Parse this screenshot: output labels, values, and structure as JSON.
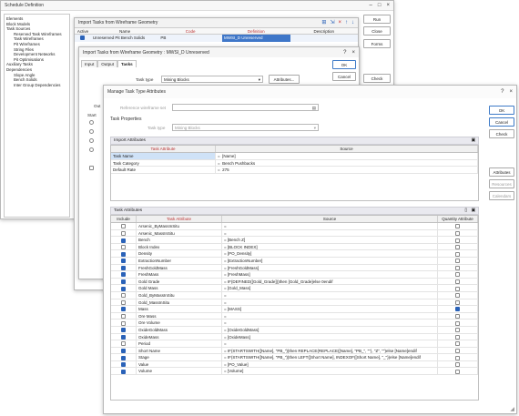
{
  "schedule": {
    "title": "Schedule Definition",
    "tree": [
      "Elements",
      "Block Models",
      "Task Sources",
      "Reserved Task Wireframes",
      "Task Wireframes",
      "Pit Wireframes",
      "String Files",
      "Development Networks",
      "Pit Optimisations",
      "Auxiliary Tasks",
      "Dependencies",
      "Slope Angle",
      "Bench Solids",
      "Inter Group Dependencies"
    ],
    "buttons": {
      "run": "Run",
      "close": "Close",
      "forms": "Forms",
      "check": "Check"
    }
  },
  "import_tasks": {
    "title": "Import Tasks from Wireframe Geometry",
    "columns": {
      "active": "Active",
      "name": "Name",
      "code": "Code",
      "definition": "Definition",
      "description": "Description"
    },
    "row": {
      "name": "Unreserved Pit Bench Solids",
      "code": "PB",
      "definition": "MWSI_D Unreserved"
    }
  },
  "import_dialog": {
    "title": "Import Tasks from Wireframe Geometry : MWSI_D Unreserved",
    "tabs": [
      "Input",
      "Output",
      "Tasks"
    ],
    "task_type_label": "Task type",
    "task_type_value": "Mining Blocks",
    "attributes_btn": "Attributes...",
    "ok": "OK",
    "cancel": "Cancel",
    "out_label": "Out",
    "start_label": "Start"
  },
  "manage": {
    "title": "Manage Task Type Attributes",
    "ref_label": "Reference wireframe set",
    "task_properties": "Task Properties",
    "task_type_label": "Task type",
    "task_type_value": "Mining Blocks",
    "buttons": {
      "ok": "OK",
      "cancel": "Cancel",
      "check": "Check",
      "attributes": "Attributes",
      "resources": "Resources",
      "calendars": "Calendars"
    },
    "import_attributes": {
      "header": "Import Attributes",
      "columns": {
        "attr": "Task Attribute",
        "source": "Source"
      },
      "rows": [
        {
          "attr": "Task Name",
          "source": "[Name]"
        },
        {
          "attr": "Task Category",
          "source": "Bench Pushbacks"
        },
        {
          "attr": "Default Rate",
          "source": "275"
        }
      ]
    },
    "task_attributes": {
      "header": "Task Attributes",
      "columns": {
        "include": "Include",
        "attr": "Task Attribute",
        "source": "Source",
        "qty": "Quantity Attribute"
      },
      "rows": [
        {
          "inc": false,
          "attr": "Arsenic_ByMassInSitu",
          "src": "",
          "qty": false
        },
        {
          "inc": false,
          "attr": "Arsenic_MassInSitu",
          "src": "",
          "qty": false
        },
        {
          "inc": true,
          "attr": "Bench",
          "src": "[Bench Z]",
          "qty": false
        },
        {
          "inc": false,
          "attr": "Block Index",
          "src": "[BLOCK INDEX]",
          "qty": false
        },
        {
          "inc": true,
          "attr": "Density",
          "src": "[PO_Density]",
          "qty": false
        },
        {
          "inc": true,
          "attr": "ExtractionNumber",
          "src": "[ExtractionNumber]",
          "qty": false
        },
        {
          "inc": true,
          "attr": "FreshGoldMass",
          "src": "[FreshGoldMass]",
          "qty": false
        },
        {
          "inc": true,
          "attr": "FreshMass",
          "src": "[FreshMass]",
          "qty": false
        },
        {
          "inc": true,
          "attr": "Gold Grade",
          "src": "IF(DEFINED([Gold_Grade]))then [Gold_Grade]else 0endif",
          "qty": false
        },
        {
          "inc": true,
          "attr": "Gold Mass",
          "src": "[Gold_Mass]",
          "qty": false
        },
        {
          "inc": false,
          "attr": "Gold_ByMassInSitu",
          "src": "",
          "qty": false
        },
        {
          "inc": false,
          "attr": "Gold_MassInSitu",
          "src": "",
          "qty": false
        },
        {
          "inc": true,
          "attr": "Mass",
          "src": "[MASS]",
          "qty": true
        },
        {
          "inc": false,
          "attr": "Ore Mass",
          "src": "",
          "qty": false
        },
        {
          "inc": false,
          "attr": "Ore Volume",
          "src": "",
          "qty": false
        },
        {
          "inc": true,
          "attr": "OxideGoldMass",
          "src": "[OxideGoldMass]",
          "qty": false
        },
        {
          "inc": true,
          "attr": "OxideMass",
          "src": "[OxideMass]",
          "qty": false
        },
        {
          "inc": false,
          "attr": "Period",
          "src": "",
          "qty": false
        },
        {
          "inc": true,
          "attr": "Short Name",
          "src": "IF(STARTSWITH([Name], \"PB_\"))then REPLACE(REPLACE([Name], \"PB_\", \"\"), \"Z\", \"\")else [Name]endif",
          "qty": false
        },
        {
          "inc": true,
          "attr": "Stage",
          "src": "IF(STARTSWITH([Name], \"PB_\"))then LEFT([Short Name], INDEXOF([Short Name], \"_\"))else [Name]endif",
          "qty": false
        },
        {
          "inc": true,
          "attr": "Value",
          "src": "[PO_Value]",
          "qty": false
        },
        {
          "inc": true,
          "attr": "Volume",
          "src": "[Volume]",
          "qty": false
        }
      ]
    }
  }
}
